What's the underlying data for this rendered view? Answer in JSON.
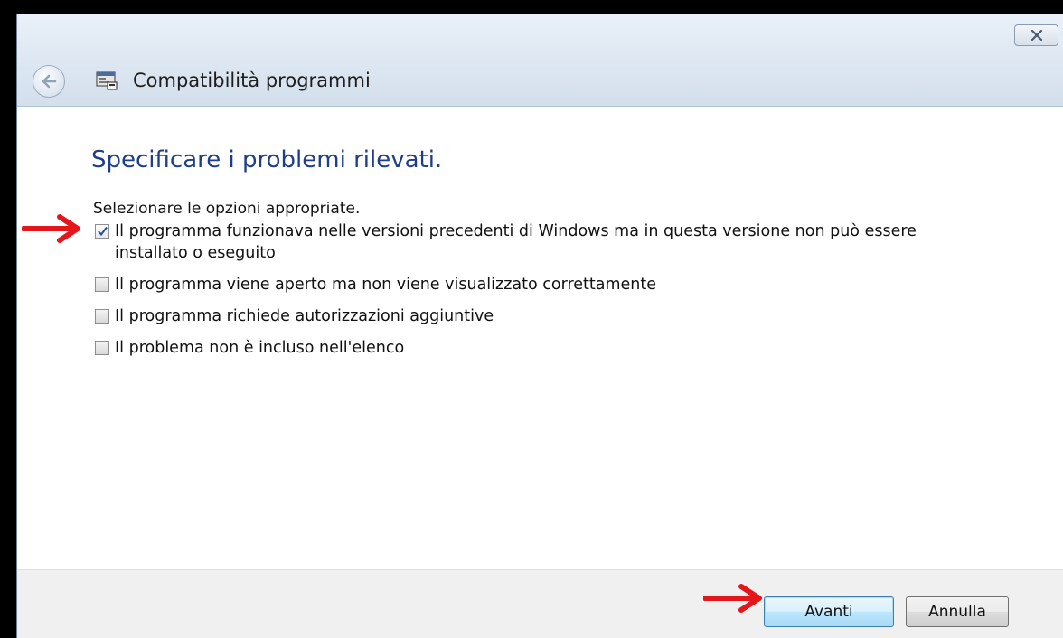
{
  "window": {
    "title": "Compatibilità programmi",
    "icons": {
      "back": "back-arrow-icon",
      "app": "program-compatibility-icon",
      "close": "close-icon"
    }
  },
  "content": {
    "heading": "Specificare i problemi rilevati.",
    "instruction": "Selezionare le opzioni appropriate.",
    "options": [
      {
        "label": "Il programma funzionava nelle versioni precedenti di Windows ma in questa versione non può essere installato o eseguito",
        "checked": true
      },
      {
        "label": "Il programma viene aperto ma non viene visualizzato correttamente",
        "checked": false
      },
      {
        "label": "Il programma richiede autorizzazioni aggiuntive",
        "checked": false
      },
      {
        "label": "Il problema non è incluso nell'elenco",
        "checked": false
      }
    ]
  },
  "footer": {
    "next_label": "Avanti",
    "cancel_label": "Annulla"
  },
  "annotations": {
    "arrow_color": "#e3161b"
  }
}
